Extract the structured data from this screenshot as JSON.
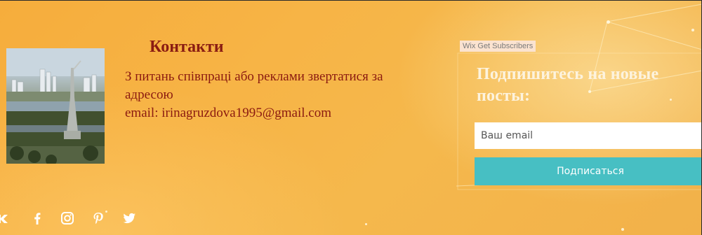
{
  "contacts": {
    "title": "Контакти",
    "line1": "З питань співпраці або реклами звертатися за адресою",
    "line2": "email: irinagruzdova1995@gmail.com"
  },
  "subscribe": {
    "badge": "Wix Get Subscribers",
    "title": "Подпишитесь на новые посты:",
    "email_placeholder": "Ваш email",
    "button_label": "Подписаться",
    "button_color": "#47bfc3"
  },
  "social": {
    "icons": [
      "vk-icon",
      "facebook-icon",
      "instagram-icon",
      "pinterest-icon",
      "twitter-icon"
    ]
  },
  "colors": {
    "background": "#f6b444",
    "heading": "#8a1c12",
    "subscribe_title": "#fdf3de"
  }
}
